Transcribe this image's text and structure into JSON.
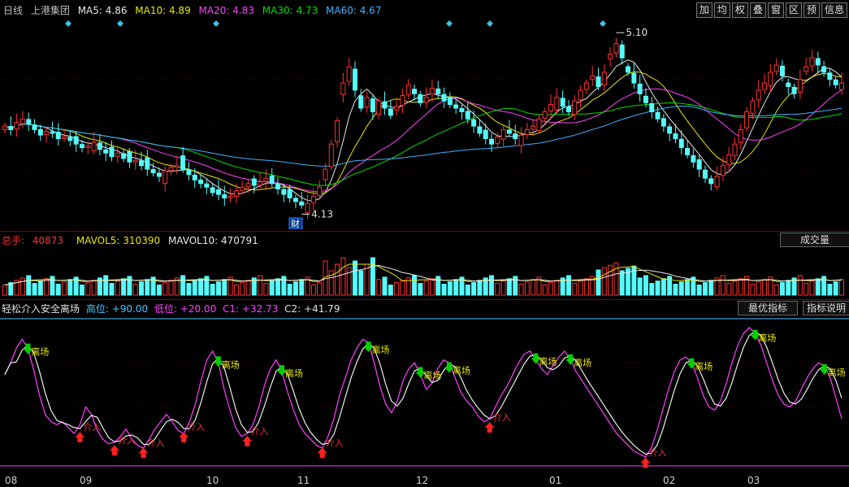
{
  "header": {
    "period": "日线",
    "stock_name": "上港集团",
    "ma": [
      {
        "label": "MA5: 4.86",
        "color": "#e8e8e8"
      },
      {
        "label": "MA10: 4.89",
        "color": "#e8e800"
      },
      {
        "label": "MA20: 4.83",
        "color": "#ff40ff"
      },
      {
        "label": "MA30: 4.73",
        "color": "#00e000"
      },
      {
        "label": "MA60: 4.67",
        "color": "#40b0ff"
      }
    ]
  },
  "toolbar": [
    "加",
    "均",
    "权",
    "叠",
    "窗",
    "区",
    "预",
    "信息"
  ],
  "price_annotations": {
    "high": "5.10",
    "low": "4.13",
    "event": "财"
  },
  "volume_header": {
    "total_label": "总手: ",
    "total_value": "40873",
    "mavol5": "MAVOL5: 310390",
    "mavol10": "MAVOL10: 470791",
    "button": "成交量"
  },
  "indicator_header": {
    "name": "轻松介入安全离场",
    "high": "高位: +90.00",
    "low": "低位: +20.00",
    "c1": "C1: +32.73",
    "c2": "C2: +41.79",
    "btn_best": "最优指标",
    "btn_help": "指标说明"
  },
  "signal_labels": {
    "exit": "离场",
    "enter": "介入"
  },
  "months": [
    "08",
    "09",
    "10",
    "11",
    "12",
    "01",
    "02",
    "03"
  ],
  "colors": {
    "up": "#ff3232",
    "down": "#54fcfc",
    "exit_arrow": "#00d000",
    "enter_arrow": "#ff2020"
  },
  "chart_data": [
    {
      "type": "candlestick",
      "title": "上港集团 日线",
      "x_start": "08",
      "ylim": [
        4.1,
        5.15
      ],
      "annotations": [
        {
          "label": "5.10",
          "kind": "high"
        },
        {
          "label": "4.13",
          "kind": "low"
        }
      ],
      "closes": [
        4.62,
        4.6,
        4.64,
        4.66,
        4.63,
        4.6,
        4.57,
        4.59,
        4.58,
        4.55,
        4.56,
        4.54,
        4.52,
        4.5,
        4.51,
        4.53,
        4.49,
        4.47,
        4.45,
        4.47,
        4.44,
        4.42,
        4.43,
        4.4,
        4.38,
        4.36,
        4.34,
        4.37,
        4.39,
        4.4,
        4.38,
        4.35,
        4.32,
        4.3,
        4.28,
        4.25,
        4.24,
        4.22,
        4.23,
        4.26,
        4.28,
        4.3,
        4.29,
        4.31,
        4.33,
        4.3,
        4.27,
        4.24,
        4.22,
        4.2,
        4.18,
        4.19,
        4.23,
        4.28,
        4.38,
        4.52,
        4.65,
        4.86,
        4.95,
        4.82,
        4.72,
        4.78,
        4.7,
        4.76,
        4.72,
        4.68,
        4.73,
        4.79,
        4.85,
        4.8,
        4.75,
        4.78,
        4.83,
        4.8,
        4.76,
        4.74,
        4.72,
        4.7,
        4.66,
        4.62,
        4.58,
        4.55,
        4.52,
        4.56,
        4.6,
        4.58,
        4.55,
        4.57,
        4.6,
        4.62,
        4.66,
        4.7,
        4.74,
        4.78,
        4.73,
        4.7,
        4.76,
        4.82,
        4.86,
        4.9,
        4.84,
        4.92,
        5.02,
        5.08,
        5.0,
        4.92,
        4.86,
        4.8,
        4.75,
        4.7,
        4.66,
        4.62,
        4.58,
        4.55,
        4.5,
        4.46,
        4.42,
        4.38,
        4.33,
        4.3,
        4.34,
        4.4,
        4.46,
        4.52,
        4.6,
        4.7,
        4.76,
        4.82,
        4.86,
        4.92,
        4.96,
        4.9,
        4.84,
        4.8,
        4.88,
        4.95,
        5.0,
        4.96,
        4.92,
        4.88,
        4.85,
        4.86
      ]
    },
    {
      "type": "bar",
      "title": "成交量",
      "series": [
        {
          "name": "MAVOL5",
          "value": 310390
        },
        {
          "name": "MAVOL10",
          "value": 470791
        }
      ]
    },
    {
      "type": "line",
      "title": "轻松介入安全离场",
      "ylim": [
        0,
        100
      ],
      "levels": {
        "high": 90.0,
        "low": 20.0
      },
      "series": [
        {
          "name": "C1",
          "last": 32.73
        },
        {
          "name": "C2",
          "last": 41.79
        }
      ],
      "c1_values": [
        62,
        70,
        80,
        86,
        80,
        65,
        48,
        35,
        30,
        28,
        30,
        26,
        22,
        28,
        40,
        35,
        24,
        18,
        15,
        16,
        20,
        25,
        18,
        14,
        12,
        18,
        25,
        30,
        35,
        30,
        24,
        22,
        30,
        42,
        58,
        72,
        78,
        70,
        52,
        38,
        26,
        20,
        22,
        28,
        40,
        55,
        66,
        72,
        64,
        50,
        38,
        28,
        22,
        18,
        14,
        12,
        20,
        32,
        48,
        60,
        72,
        80,
        86,
        84,
        70,
        54,
        42,
        36,
        44,
        58,
        66,
        70,
        62,
        52,
        56,
        66,
        72,
        70,
        60,
        50,
        44,
        40,
        34,
        30,
        32,
        40,
        48,
        54,
        62,
        70,
        76,
        78,
        72,
        66,
        62,
        68,
        74,
        78,
        72,
        64,
        58,
        52,
        46,
        40,
        34,
        28,
        22,
        18,
        14,
        10,
        8,
        6,
        12,
        24,
        38,
        52,
        64,
        72,
        74,
        70,
        60,
        48,
        40,
        38,
        44,
        56,
        70,
        82,
        90,
        94,
        90,
        82,
        70,
        58,
        48,
        42,
        40,
        44,
        52,
        60,
        66,
        70,
        68,
        60,
        46,
        32
      ]
    }
  ]
}
